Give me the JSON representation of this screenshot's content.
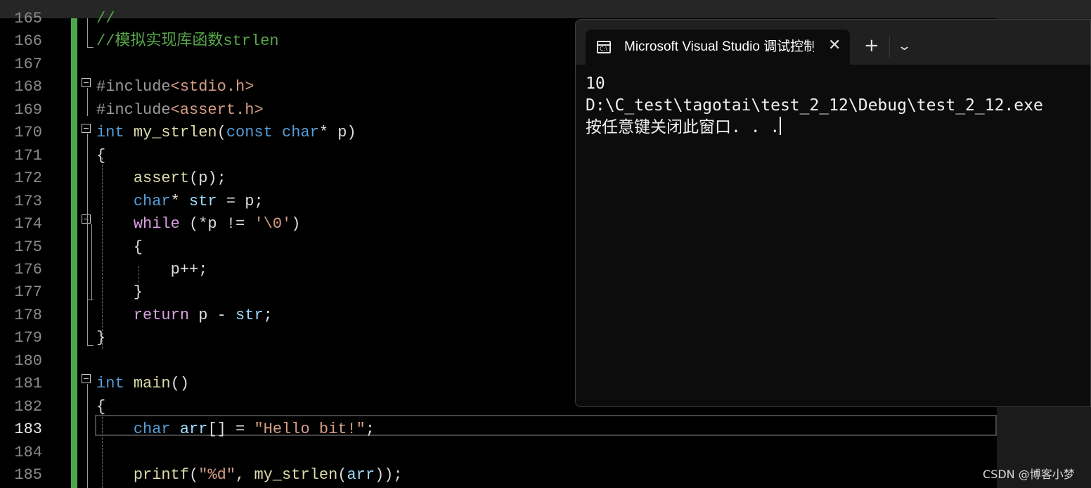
{
  "editor": {
    "line_numbers": [
      "165",
      "166",
      "167",
      "168",
      "169",
      "170",
      "171",
      "172",
      "173",
      "174",
      "175",
      "176",
      "177",
      "178",
      "179",
      "180",
      "181",
      "182",
      "183",
      "184",
      "185"
    ],
    "current_line": "183",
    "lines": [
      {
        "n": "165",
        "parts": [
          [
            "cmt",
            "//"
          ]
        ]
      },
      {
        "n": "166",
        "parts": [
          [
            "cmt",
            "//模拟实现库函数strlen"
          ]
        ]
      },
      {
        "n": "167",
        "parts": []
      },
      {
        "n": "168",
        "parts": [
          [
            "pre",
            "#include"
          ],
          [
            "inc",
            "<stdio.h>"
          ]
        ]
      },
      {
        "n": "169",
        "parts": [
          [
            "pre",
            "#include"
          ],
          [
            "inc",
            "<assert.h>"
          ]
        ]
      },
      {
        "n": "170",
        "parts": [
          [
            "kw",
            "int"
          ],
          [
            "p",
            " "
          ],
          [
            "fn",
            "my_strlen"
          ],
          [
            "p",
            "("
          ],
          [
            "kw",
            "const char"
          ],
          [
            "p",
            "* "
          ],
          [
            "p",
            "p)"
          ]
        ]
      },
      {
        "n": "171",
        "parts": [
          [
            "p",
            "{"
          ]
        ]
      },
      {
        "n": "172",
        "parts": [
          [
            "p",
            "    "
          ],
          [
            "fn",
            "assert"
          ],
          [
            "p",
            "(p);"
          ]
        ]
      },
      {
        "n": "173",
        "parts": [
          [
            "p",
            "    "
          ],
          [
            "kw",
            "char"
          ],
          [
            "p",
            "* "
          ],
          [
            "var",
            "str"
          ],
          [
            "p",
            " = p;"
          ]
        ]
      },
      {
        "n": "174",
        "parts": [
          [
            "p",
            "    "
          ],
          [
            "ctl",
            "while"
          ],
          [
            "p",
            " (*p != "
          ],
          [
            "str",
            "'\\0'"
          ],
          [
            "p",
            ")"
          ]
        ]
      },
      {
        "n": "175",
        "parts": [
          [
            "p",
            "    {"
          ]
        ]
      },
      {
        "n": "176",
        "parts": [
          [
            "p",
            "        p++;"
          ]
        ]
      },
      {
        "n": "177",
        "parts": [
          [
            "p",
            "    }"
          ]
        ]
      },
      {
        "n": "178",
        "parts": [
          [
            "p",
            "    "
          ],
          [
            "ctl",
            "return"
          ],
          [
            "p",
            " p - "
          ],
          [
            "var",
            "str"
          ],
          [
            "p",
            ";"
          ]
        ]
      },
      {
        "n": "179",
        "parts": [
          [
            "p",
            "}"
          ]
        ]
      },
      {
        "n": "180",
        "parts": []
      },
      {
        "n": "181",
        "parts": [
          [
            "kw",
            "int"
          ],
          [
            "p",
            " "
          ],
          [
            "fn",
            "main"
          ],
          [
            "p",
            "()"
          ]
        ]
      },
      {
        "n": "182",
        "parts": [
          [
            "p",
            "{"
          ]
        ]
      },
      {
        "n": "183",
        "parts": [
          [
            "p",
            "    "
          ],
          [
            "kw",
            "char"
          ],
          [
            "p",
            " "
          ],
          [
            "var",
            "arr"
          ],
          [
            "p",
            "[] = "
          ],
          [
            "str",
            "\"Hello bit!\""
          ],
          [
            "p",
            ";"
          ]
        ]
      },
      {
        "n": "184",
        "parts": []
      },
      {
        "n": "185",
        "parts": [
          [
            "p",
            "    "
          ],
          [
            "fn",
            "printf"
          ],
          [
            "p",
            "("
          ],
          [
            "str",
            "\"%d\""
          ],
          [
            "p",
            ", "
          ],
          [
            "fn",
            "my_strlen"
          ],
          [
            "p",
            "("
          ],
          [
            "var",
            "arr"
          ],
          [
            "p",
            "));"
          ]
        ]
      }
    ],
    "colors": {
      "keyword": "#569cd6",
      "control": "#d8a0df",
      "function": "#dcdcaa",
      "variable": "#9cdcfe",
      "string": "#d69d85",
      "comment": "#57a64a",
      "change_bar": "#4ca74c"
    }
  },
  "terminal": {
    "tab_title": "Microsoft Visual Studio 调试控制台",
    "icon": "console-icon",
    "new_tab_label": "+",
    "dropdown_label": "⌄",
    "close_label": "✕",
    "output_lines": [
      "10",
      "D:\\C_test\\tagotai\\test_2_12\\Debug\\test_2_12.exe",
      "按任意键关闭此窗口. . ."
    ]
  },
  "watermark": "CSDN @博客小梦"
}
